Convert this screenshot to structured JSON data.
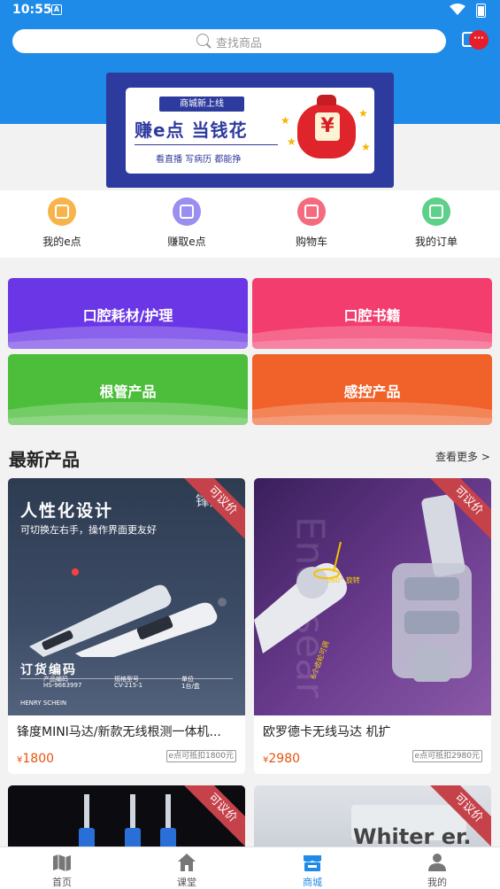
{
  "status_bar": {
    "time": "10:55",
    "notification_icon": "A"
  },
  "search": {
    "placeholder": "查找商品"
  },
  "message_badge": "···",
  "banner": {
    "tag": "商城新上线",
    "title": "赚e点 当钱花",
    "subtitle": "看直播 写病历 都能挣",
    "symbol": "¥"
  },
  "quick_nav": [
    {
      "label": "我的e点",
      "icon": "coins-icon",
      "color": "#f7b44a"
    },
    {
      "label": "赚取e点",
      "icon": "earn-icon",
      "color": "#9a8ff0"
    },
    {
      "label": "购物车",
      "icon": "cart-icon",
      "color": "#f46b7e"
    },
    {
      "label": "我的订单",
      "icon": "order-icon",
      "color": "#5dd08a"
    }
  ],
  "categories": [
    {
      "label": "口腔耗材/护理",
      "color": "#6b37e6"
    },
    {
      "label": "口腔书籍",
      "color": "#f23d6e"
    },
    {
      "label": "根管产品",
      "color": "#4dbe3c"
    },
    {
      "label": "感控产品",
      "color": "#f0622a"
    }
  ],
  "section": {
    "title": "最新产品",
    "more": "查看更多 >"
  },
  "products": [
    {
      "ribbon": "可议价",
      "name": "锋度MINI马达/新款无线根测一体机...",
      "currency": "¥",
      "price": "1800",
      "epoint": "e点可抵扣1800元",
      "img_text": {
        "headline": "人性化设计",
        "subline": "可切换左右手，操作界面更友好",
        "order_title": "订货编码",
        "brand_corner": "锋度",
        "brand": "HENRY SCHEIN",
        "table_headers": [
          "产品编码",
          "规格型号",
          "单位"
        ],
        "table_values": [
          "HS-9663997",
          "CV-215-1",
          "1台/盒"
        ]
      }
    },
    {
      "ribbon": "可议价",
      "name": "欧罗德卡无线马达 机扩",
      "currency": "¥",
      "price": "2980",
      "epoint": "e点可抵扣2980元",
      "img_text": {
        "watermark": "Endosear",
        "angle": "360° 旋转",
        "gears": "6个齿轮可调"
      }
    },
    {
      "ribbon": "可议价"
    },
    {
      "ribbon": "可议价",
      "img_text": {
        "watermark": "Whiter  er."
      }
    }
  ],
  "tabbar": [
    {
      "label": "首页",
      "icon": "map-icon",
      "active": false
    },
    {
      "label": "课堂",
      "icon": "house-icon",
      "active": false
    },
    {
      "label": "商城",
      "icon": "store-icon",
      "active": true
    },
    {
      "label": "我的",
      "icon": "user-icon",
      "active": false
    }
  ]
}
